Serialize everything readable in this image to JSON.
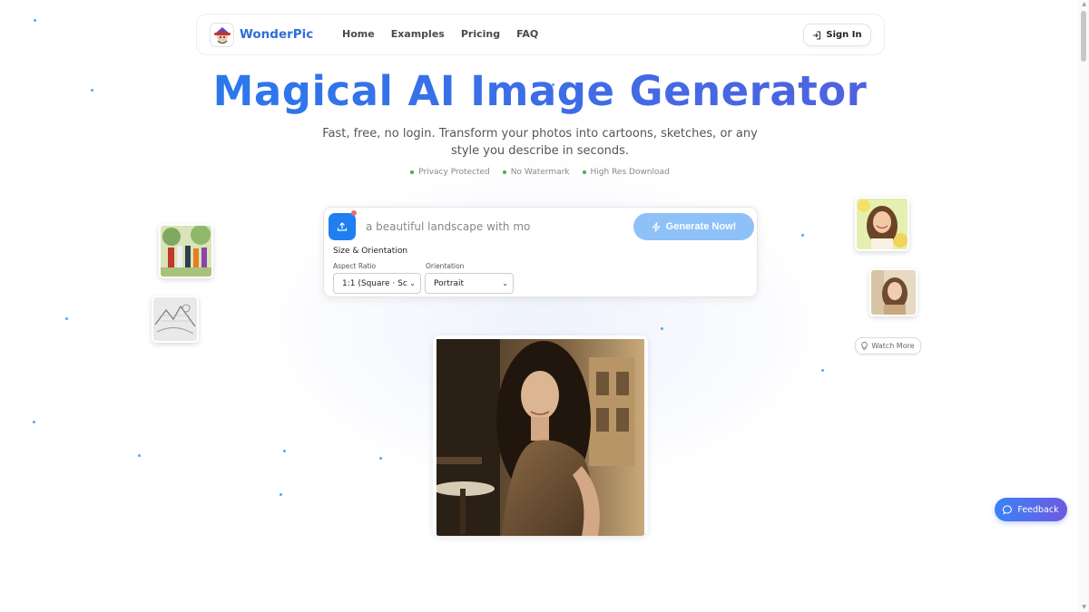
{
  "nav": {
    "brand": "WonderPic",
    "links": [
      {
        "label": "Home"
      },
      {
        "label": "Examples"
      },
      {
        "label": "Pricing"
      },
      {
        "label": "FAQ"
      }
    ],
    "sign_in": "Sign In"
  },
  "hero": {
    "title": "Magical AI Image Generator",
    "subtitle": "Fast, free, no login. Transform your photos into cartoons, sketches, or any style you describe in seconds.",
    "features": [
      "Privacy Protected",
      "No Watermark",
      "High Res Download"
    ]
  },
  "generator": {
    "prompt_value": "a beautiful landscape with mo",
    "generate_label": "Generate Now!",
    "size_section_label": "Size & Orientation",
    "aspect_ratio_label": "Aspect Ratio",
    "aspect_ratio_value": "1:1 (Square · Sc",
    "orientation_label": "Orientation",
    "orientation_value": "Portrait"
  },
  "gallery": {
    "watch_more": "Watch More"
  },
  "feedback_label": "Feedback",
  "colors": {
    "brand_blue": "#1f7ff0",
    "title_gradient_end": "#5b5bdc",
    "generate_button": "#8ec1f7",
    "feature_dot": "#34b35a"
  },
  "icons": {
    "upload": "upload-icon",
    "generate": "bolt-icon",
    "sign_in": "sign-in-icon",
    "watch_more": "lightbulb-icon",
    "feedback": "chat-bubble-icon"
  }
}
